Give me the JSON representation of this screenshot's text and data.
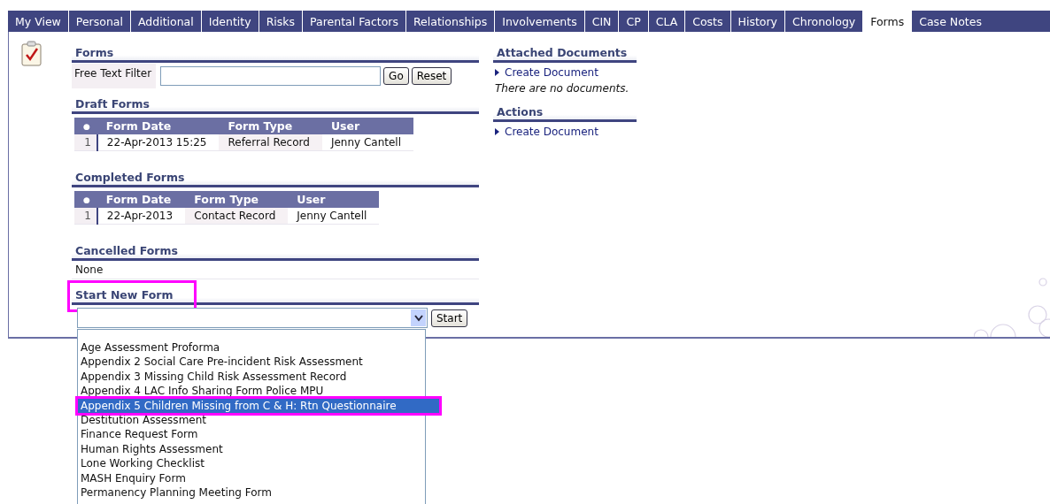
{
  "tabs": [
    {
      "label": "My View",
      "selected": false
    },
    {
      "label": "Personal",
      "selected": false
    },
    {
      "label": "Additional",
      "selected": false
    },
    {
      "label": "Identity",
      "selected": false
    },
    {
      "label": "Risks",
      "selected": false
    },
    {
      "label": "Parental Factors",
      "selected": false
    },
    {
      "label": "Relationships",
      "selected": false
    },
    {
      "label": "Involvements",
      "selected": false
    },
    {
      "label": "CIN",
      "selected": false
    },
    {
      "label": "CP",
      "selected": false
    },
    {
      "label": "CLA",
      "selected": false
    },
    {
      "label": "Costs",
      "selected": false
    },
    {
      "label": "History",
      "selected": false
    },
    {
      "label": "Chronology",
      "selected": false
    },
    {
      "label": "Forms",
      "selected": true
    },
    {
      "label": "Case Notes",
      "selected": false
    }
  ],
  "forms": {
    "title": "Forms",
    "filter_label": "Free Text Filter",
    "go": "Go",
    "reset": "Reset"
  },
  "draft": {
    "title": "Draft Forms",
    "columns": [
      "●",
      "Form Date",
      "Form Type",
      "User"
    ],
    "rows": [
      [
        "1",
        "22-Apr-2013 15:25",
        "Referral Record",
        "Jenny Cantell"
      ]
    ]
  },
  "completed": {
    "title": "Completed Forms",
    "columns": [
      "●",
      "Form Date",
      "Form Type",
      "User"
    ],
    "rows": [
      [
        "1",
        "22-Apr-2013",
        "Contact Record",
        "Jenny Cantell"
      ]
    ]
  },
  "cancelled": {
    "title": "Cancelled Forms",
    "text": "None"
  },
  "start": {
    "title": "Start New Form",
    "highlighted": true,
    "button": "Start",
    "options": [
      {
        "label": "Age Assessment Proforma",
        "selected": false
      },
      {
        "label": "Appendix 2 Social Care Pre-incident Risk Assessment",
        "selected": false
      },
      {
        "label": "Appendix 3 Missing Child Risk Assessment Record",
        "selected": false
      },
      {
        "label": "Appendix 4 LAC Info Sharing Form Police MPU",
        "selected": false
      },
      {
        "label": "Appendix 5 Children Missing from C & H: Rtn Questionnaire",
        "selected": true
      },
      {
        "label": "Destitution Assessment",
        "selected": false
      },
      {
        "label": "Finance Request Form",
        "selected": false
      },
      {
        "label": "Human Rights Assessment",
        "selected": false
      },
      {
        "label": "Lone Working Checklist",
        "selected": false
      },
      {
        "label": "MASH Enquiry Form",
        "selected": false
      },
      {
        "label": "Permanency Planning Meeting Form",
        "selected": false
      }
    ]
  },
  "attached": {
    "title": "Attached Documents",
    "link": "Create Document",
    "empty": "There are no documents."
  },
  "actions": {
    "title": "Actions",
    "link": "Create Document"
  }
}
